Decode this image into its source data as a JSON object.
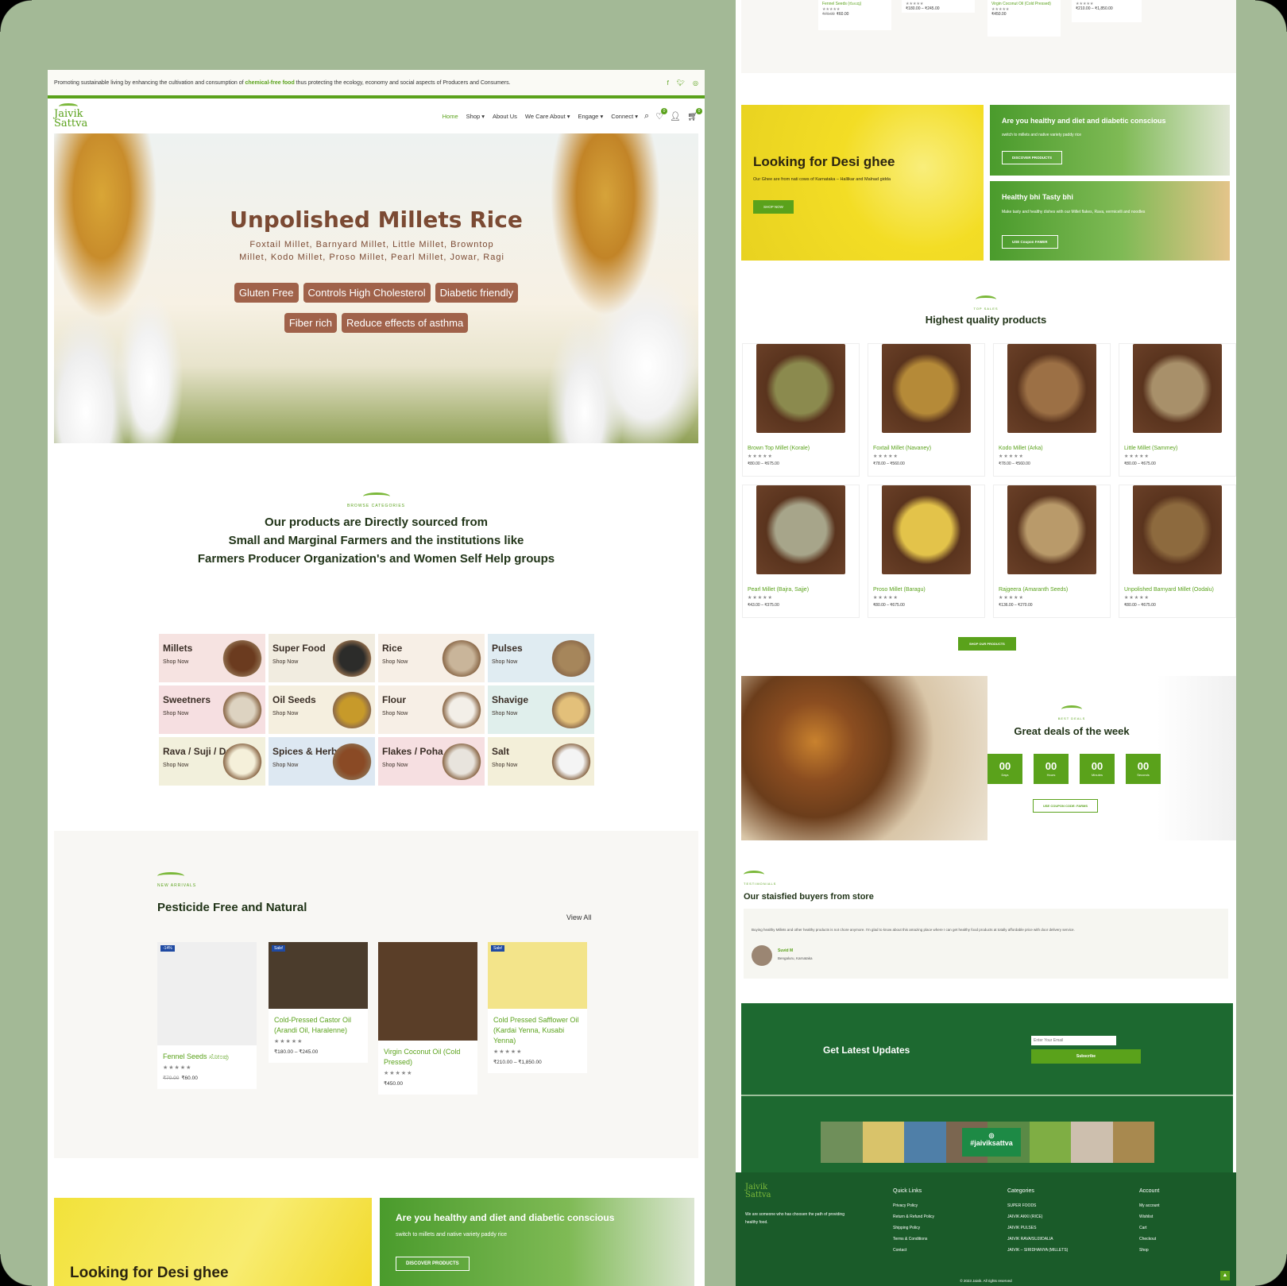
{
  "topbar": {
    "text_before": "Promoting sustainable living by enhancing the cultivation and consumption of ",
    "highlight": "chemical-free food",
    "text_after": " thus protecting the ecology, economy and social aspects of Producers and Consumers."
  },
  "brand": {
    "line1": "Jaivik",
    "line2": "Sattva"
  },
  "menu": [
    {
      "label": "Home"
    },
    {
      "label": "Shop"
    },
    {
      "label": "About Us"
    },
    {
      "label": "We Care About"
    },
    {
      "label": "Engage"
    },
    {
      "label": "Connect"
    }
  ],
  "cart_count": "0",
  "wishlist_count": "0",
  "hero": {
    "title": "Unpolished Millets Rice",
    "subtitle": "Foxtail Millet, Barnyard Millet, Little Millet, Browntop Millet, Kodo Millet, Proso Millet, Pearl Millet, Jowar, Ragi",
    "pills_row1": [
      "Gluten Free",
      "Controls High Cholesterol",
      "Diabetic friendly"
    ],
    "pills_row2": [
      "Fiber rich",
      "Reduce effects of asthma"
    ]
  },
  "browse": {
    "kicker": "BROWSE CATEGORIES",
    "line1": "Our products are Directly sourced from",
    "line2": "Small and Marginal Farmers and the institutions like",
    "line3": "Farmers Producer Organization's and Women Self Help groups"
  },
  "categories": [
    {
      "name": "Millets",
      "cta": "Shop Now",
      "bg": "#f6e3e1"
    },
    {
      "name": "Super Food",
      "cta": "Shop Now",
      "bg": "#f1ece0"
    },
    {
      "name": "Rice",
      "cta": "Shop Now",
      "bg": "#f7efe6"
    },
    {
      "name": "Pulses",
      "cta": "Shop Now",
      "bg": "#e0ecf2"
    },
    {
      "name": "Sweetners",
      "cta": "Shop Now",
      "bg": "#f6dfe1"
    },
    {
      "name": "Oil Seeds",
      "cta": "Shop Now",
      "bg": "#f5efdf"
    },
    {
      "name": "Flour",
      "cta": "Shop Now",
      "bg": "#f7efe6"
    },
    {
      "name": "Shavige",
      "cta": "Shop Now",
      "bg": "#e0efec"
    },
    {
      "name": "Rava / Suji / Dalia",
      "cta": "Shop Now",
      "bg": "#f2f0dc"
    },
    {
      "name": "Spices & Herbs",
      "cta": "Shop Now",
      "bg": "#dde8f2"
    },
    {
      "name": "Flakes / Poha",
      "cta": "Shop Now",
      "bg": "#f6dfe1"
    },
    {
      "name": "Salt",
      "cta": "Shop Now",
      "bg": "#f3efd9"
    }
  ],
  "arrivals": {
    "kicker": "NEW ARRIVALS",
    "title": "Pesticide Free and Natural",
    "view_all": "View All",
    "products": [
      {
        "tag": "-14%",
        "name": "Fennel Seeds ಸೋಂಪು",
        "stars": "★★★★★",
        "old_price": "₹70.00",
        "price": "₹60.00"
      },
      {
        "tag": "Sale!",
        "name": "Cold-Pressed Castor Oil (Arandi Oil, Haralenne)",
        "stars": "★★★★★",
        "price": "₹180.00 – ₹245.00"
      },
      {
        "tag": "",
        "name": "Virgin Coconut Oil (Cold Pressed)",
        "stars": "★★★★★",
        "price": "₹450.00"
      },
      {
        "tag": "Sale!",
        "name": "Cold Pressed Safflower Oil (Kardai Yenna, Kusabi Yenna)",
        "stars": "★★★★★",
        "price": "₹210.00 – ₹1,850.00"
      }
    ]
  },
  "promo": {
    "ghee_title": "Looking for Desi ghee",
    "ghee_sub": "Our Ghee are from nati cows of Karnataka – Hallikar and Malnad gidda",
    "ghee_btn": "SHOP NOW",
    "healthy_title": "Are you healthy and diet and diabetic conscious",
    "healthy_sub": "switch to millets and native variety paddy rice",
    "healthy_btn": "DISCOVER PRODUCTS",
    "tasty_title": "Healthy bhi Tasty bhi",
    "tasty_sub": "Make tasty and healthy dishes with our Millet flakes, Rava, vermicelli and noodles",
    "tasty_btn": "USE Coupon FAMER"
  },
  "right_top": {
    "items": [
      {
        "name": "Fennel Seeds (ಸೋಂಪು)",
        "price_old": "₹70.00",
        "price": "₹60.00"
      },
      {
        "name": "",
        "price": "₹180.00 – ₹245.00"
      },
      {
        "name": "Virgin Coconut Oil (Cold Pressed)",
        "price": "₹450.00"
      },
      {
        "name": "",
        "price": "₹210.00 – ₹1,850.00"
      }
    ]
  },
  "top_sales": {
    "kicker": "TOP SALES",
    "title": "Highest quality products",
    "button": "SHOP OUR PRODUCTS",
    "products": [
      {
        "name": "Brown Top Millet (Korale)",
        "price": "₹80.00 – ₹675.00",
        "color": "#8b8a4e"
      },
      {
        "name": "Foxtail Millet (Navaney)",
        "price": "₹78.00 – ₹560.00",
        "color": "#b58a38"
      },
      {
        "name": "Kodo Millet (Arka)",
        "price": "₹78.00 – ₹560.00",
        "color": "#9c7045"
      },
      {
        "name": "Little Millet (Sammey)",
        "price": "₹80.00 – ₹675.00",
        "color": "#a8906a"
      },
      {
        "name": "Pearl Millet (Bajra, Sajje)",
        "price": "₹43.00 – ₹375.00",
        "color": "#a7a58a"
      },
      {
        "name": "Proso Millet (Baragu)",
        "price": "₹80.00 – ₹675.00",
        "color": "#e3c34a"
      },
      {
        "name": "Rajgeera (Amaranth Seeds)",
        "price": "₹136.00 – ₹270.00",
        "color": "#b99a6a"
      },
      {
        "name": "Unpolished Barnyard Millet (Oodalu)",
        "price": "₹80.00 – ₹675.00",
        "color": "#8d6a3e"
      }
    ]
  },
  "deals": {
    "kicker": "BEST DEALS",
    "title": "Great deals of the week",
    "days": "00",
    "days_label": "Days",
    "hours": "00",
    "hours_label": "Hours",
    "minutes": "00",
    "minutes_label": "Minutes",
    "seconds": "00",
    "seconds_label": "Seconds",
    "coupon": "USE COUPON CODE: FARMS"
  },
  "testimonials": {
    "kicker": "TESTIMONIALS",
    "title": "Our staisfied buyers from store",
    "quote": "Buying healthy Millets and other healthy products is not chore anymore. I'm glad to know about this amazing place where I can get healthy food products at totally affordable price with door delivery service.",
    "author": "Suvid M",
    "location": "Bengaluru, Karnataka"
  },
  "newsletter": {
    "title": "Get Latest Updates",
    "placeholder": "Enter Your Email",
    "button": "Subscribe"
  },
  "instagram": {
    "tag": "#jaiviksattva"
  },
  "footer": {
    "about": "We are someone who has choosen the path of providing healthy food.",
    "quick_title": "Quick Links",
    "quick": [
      "Privacy Policy",
      "Return & Refund Policy",
      "Shipping Policy",
      "Terms & Conditions",
      "Contact"
    ],
    "cat_title": "Categories",
    "cats": [
      "SUPER FOODS",
      "JAIVIK AKKI (RICE)",
      "JAIVIK PULSES",
      "JAIVIK RAVA/SUJI/DALIA",
      "JAIVIK – SIRIDHANYA (MILLETS)"
    ],
    "acc_title": "Account",
    "acc": [
      "My account",
      "Wishlist",
      "Cart",
      "Checkout",
      "Shop"
    ],
    "copyright": "© 2023 Jaivik. All rights reserved"
  }
}
